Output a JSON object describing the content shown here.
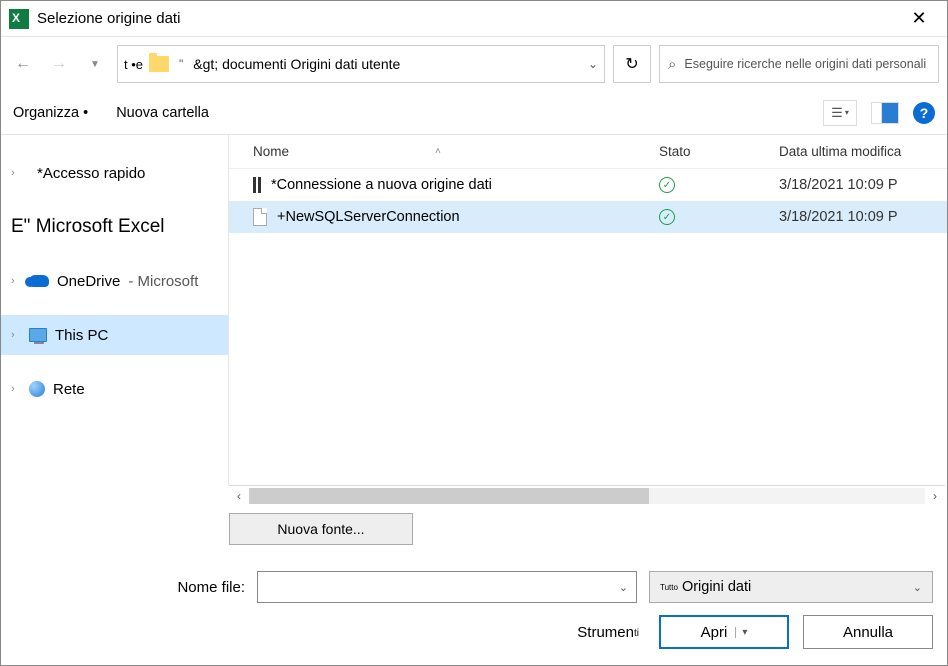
{
  "title": "Selezione origine dati",
  "nav": {
    "path_prefix": "t •e",
    "path": "&gt; documenti  Origini dati utente"
  },
  "search": {
    "placeholder": "Eseguire ricerche nelle origini dati personali"
  },
  "toolbar": {
    "organize": "Organizza •",
    "new_folder": "Nuova cartella"
  },
  "sidebar": {
    "items": [
      {
        "label": "*Accesso rapido"
      },
      {
        "label": "E\" Microsoft Excel"
      },
      {
        "label": "OneDrive",
        "suffix": " - Microsoft"
      },
      {
        "label": "This PC"
      },
      {
        "label": "Rete"
      }
    ]
  },
  "columns": {
    "name": "Nome",
    "status": "Stato",
    "date": "Data ultima modifica"
  },
  "files": [
    {
      "name": "*Connessione a nuova origine dati",
      "status": "ok",
      "date": "3/18/2021 10:09 P"
    },
    {
      "name": "+NewSQLServerConnection",
      "status": "ok",
      "date": "3/18/2021 10:09 P"
    }
  ],
  "new_source": "Nuova fonte...",
  "bottom": {
    "file_label": "Nome file:",
    "filter_prefix": "Tutto",
    "filter": "Origini dati",
    "tools": "Strumen",
    "tools_suffix": "ti",
    "open": "Apri",
    "cancel": "Annulla"
  }
}
